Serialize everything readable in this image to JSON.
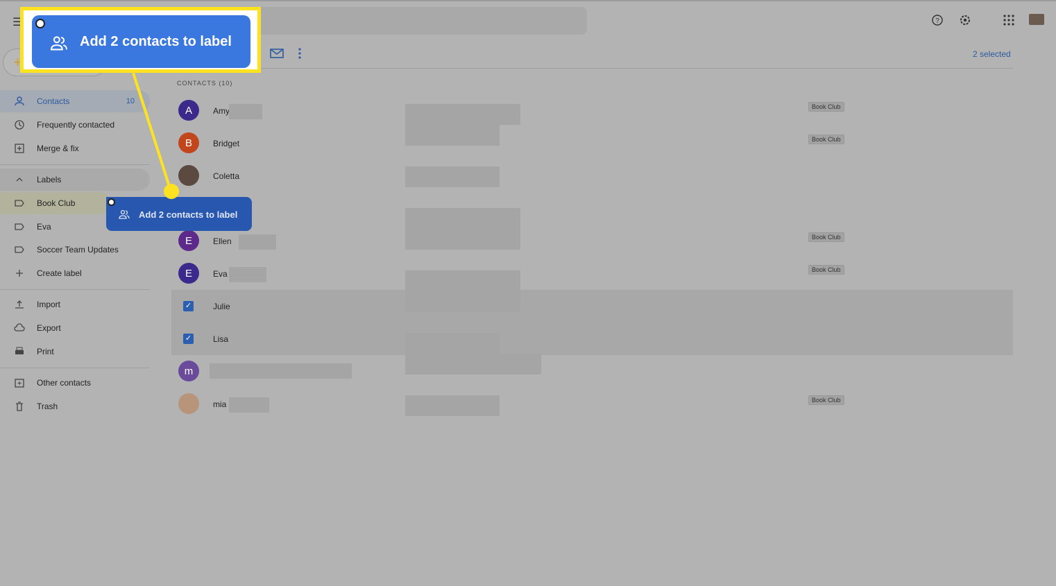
{
  "header": {
    "selected_text": "2 selected",
    "icons": [
      "menu-icon",
      "help-icon",
      "settings-icon",
      "apps-icon",
      "account-avatar"
    ]
  },
  "sidebar": {
    "items": [
      {
        "label": "Contacts",
        "count": "10"
      },
      {
        "label": "Frequently contacted"
      },
      {
        "label": "Merge & fix"
      }
    ],
    "labels_heading": "Labels",
    "labels": [
      {
        "label": "Book Club"
      },
      {
        "label": "Eva"
      },
      {
        "label": "Soccer Team Updates"
      },
      {
        "label": "Create label"
      }
    ],
    "tools": [
      {
        "label": "Import"
      },
      {
        "label": "Export"
      },
      {
        "label": "Print"
      }
    ],
    "other": [
      {
        "label": "Other contacts"
      },
      {
        "label": "Trash"
      }
    ]
  },
  "main": {
    "heading": "CONTACTS (10)",
    "contacts": [
      {
        "initial": "A",
        "name": "Amy",
        "color": "#3b2a8c",
        "label": "Book Club"
      },
      {
        "initial": "B",
        "name": "Bridget",
        "color": "#c2461c",
        "label": "Book Club"
      },
      {
        "initial": "",
        "name": "Coletta",
        "color": "#5a4a40",
        "label": ""
      },
      {
        "initial": "",
        "name": "",
        "color": "",
        "label": ""
      },
      {
        "initial": "E",
        "name": "Ellen",
        "color": "#5d2a8c",
        "label": "Book Club"
      },
      {
        "initial": "E",
        "name": "Eva",
        "color": "#3b2a8c",
        "label": "Book Club"
      },
      {
        "initial": "",
        "name": "Julie",
        "color": "",
        "label": "",
        "selected": true
      },
      {
        "initial": "",
        "name": "Lisa",
        "color": "",
        "label": "",
        "selected": true
      },
      {
        "initial": "m",
        "name": "",
        "color": "#6a4a9a",
        "label": ""
      },
      {
        "initial": "",
        "name": "mia",
        "color": "#b8957a",
        "label": "Book Club"
      }
    ]
  },
  "drag_chip": {
    "text": "Add 2 contacts to label"
  },
  "callout": {
    "text": "Add 2 contacts to label",
    "color": "#fde221"
  }
}
